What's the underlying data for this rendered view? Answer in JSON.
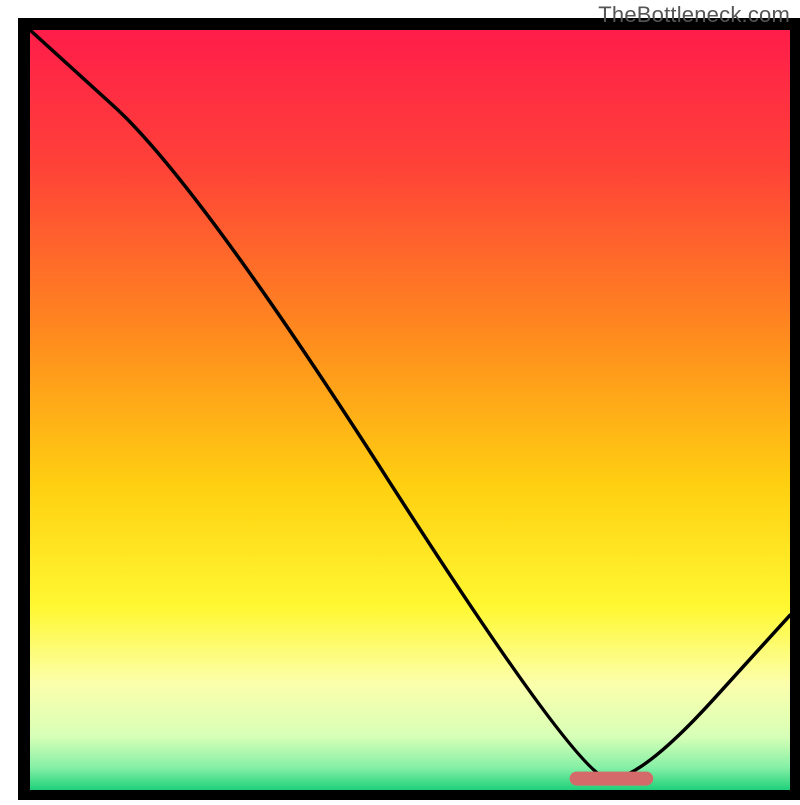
{
  "watermark": "TheBottleneck.com",
  "chart_data": {
    "type": "line",
    "title": "",
    "xlabel": "",
    "ylabel": "",
    "xlim": [
      0,
      100
    ],
    "ylim": [
      0,
      100
    ],
    "curve": [
      {
        "x": 0,
        "y": 100
      },
      {
        "x": 22,
        "y": 80
      },
      {
        "x": 72,
        "y": 2
      },
      {
        "x": 80,
        "y": 1
      },
      {
        "x": 100,
        "y": 23
      }
    ],
    "marker": {
      "x_start": 71,
      "x_end": 82,
      "y": 1.5
    },
    "gradient_stops": [
      {
        "pct": 0,
        "color": "#ff1d4a"
      },
      {
        "pct": 18,
        "color": "#ff4238"
      },
      {
        "pct": 40,
        "color": "#ff8a1e"
      },
      {
        "pct": 60,
        "color": "#ffd011"
      },
      {
        "pct": 76,
        "color": "#fff832"
      },
      {
        "pct": 86,
        "color": "#fcffac"
      },
      {
        "pct": 93,
        "color": "#d7ffb7"
      },
      {
        "pct": 97,
        "color": "#86f0a6"
      },
      {
        "pct": 100,
        "color": "#1fd07a"
      }
    ],
    "grid": false,
    "legend": false
  }
}
